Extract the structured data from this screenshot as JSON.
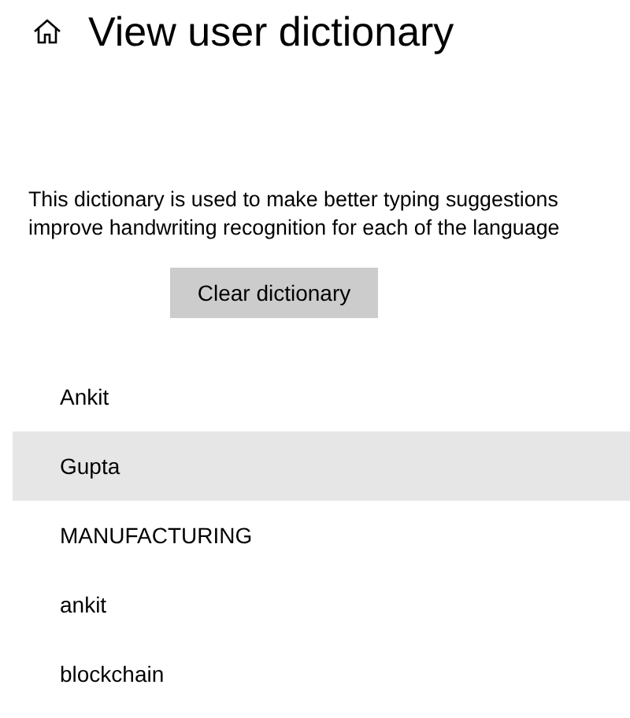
{
  "header": {
    "title": "View user dictionary"
  },
  "description_lines": [
    "This dictionary is used to make better typing suggestions",
    "improve handwriting recognition for each of the language"
  ],
  "clear_button": {
    "label": "Clear dictionary"
  },
  "words": [
    {
      "label": "Ankit",
      "selected": false
    },
    {
      "label": "Gupta",
      "selected": true
    },
    {
      "label": "MANUFACTURING",
      "selected": false
    },
    {
      "label": "ankit",
      "selected": false
    },
    {
      "label": "blockchain",
      "selected": false
    }
  ]
}
